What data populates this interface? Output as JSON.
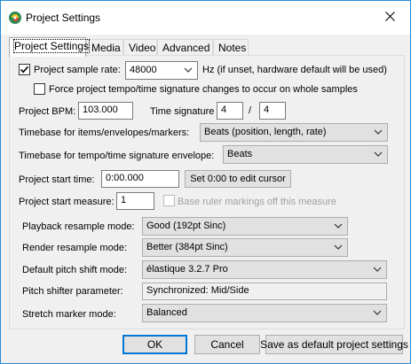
{
  "window": {
    "title": "Project Settings",
    "close_glyph": "×"
  },
  "tabs": [
    {
      "label": "Project Settings",
      "active": true
    },
    {
      "label": "Media"
    },
    {
      "label": "Video"
    },
    {
      "label": "Advanced"
    },
    {
      "label": "Notes"
    }
  ],
  "sample_rate": {
    "checkbox_label": "Project sample rate:",
    "checked": true,
    "value": "48000",
    "hint": "Hz (if unset, hardware default will be used)"
  },
  "force_tempo": {
    "label": "Force project tempo/time signature changes to occur on whole samples",
    "checked": false
  },
  "bpm": {
    "label": "Project BPM:",
    "value": "103.000"
  },
  "time_signature": {
    "label": "Time signature",
    "numerator": "4",
    "separator": "/",
    "denominator": "4"
  },
  "timebase_items": {
    "label": "Timebase for items/envelopes/markers:",
    "value": "Beats (position, length, rate)"
  },
  "timebase_tempo": {
    "label": "Timebase for tempo/time signature envelope:",
    "value": "Beats"
  },
  "start_time": {
    "label": "Project start time:",
    "value": "0:00.000",
    "button": "Set 0:00 to edit cursor"
  },
  "start_measure": {
    "label": "Project start measure:",
    "value": "1",
    "base_ruler_label": "Base ruler markings off this measure",
    "base_ruler_checked": false
  },
  "playback_resample": {
    "label": "Playback resample mode:",
    "value": "Good (192pt Sinc)"
  },
  "render_resample": {
    "label": "Render resample mode:",
    "value": "Better (384pt Sinc)"
  },
  "pitch_shift_mode": {
    "label": "Default pitch shift mode:",
    "value": "élastique 3.2.7 Pro"
  },
  "pitch_param": {
    "label": "Pitch shifter parameter:",
    "value": "Synchronized:  Mid/Side"
  },
  "stretch_marker": {
    "label": "Stretch marker mode:",
    "value": "Balanced"
  },
  "buttons": {
    "ok": "OK",
    "cancel": "Cancel",
    "save_default": "Save as default project settings"
  },
  "colors": {
    "accent": "#0078d7",
    "title_border": "#2a8ad4",
    "dialog_bg": "#f0f0f0"
  }
}
